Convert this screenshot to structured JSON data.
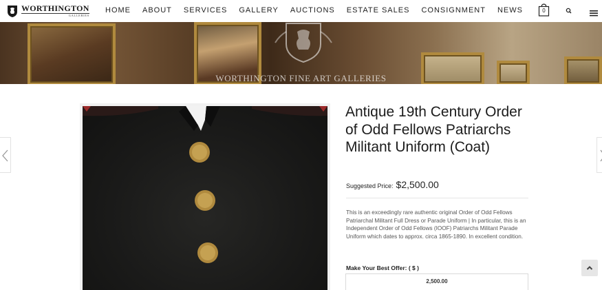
{
  "brand": {
    "name": "WORTHINGTON",
    "sub": "GALLERIES"
  },
  "nav": {
    "items": [
      {
        "label": "HOME"
      },
      {
        "label": "ABOUT"
      },
      {
        "label": "SERVICES"
      },
      {
        "label": "GALLERY"
      },
      {
        "label": "AUCTIONS"
      },
      {
        "label": "ESTATE SALES"
      },
      {
        "label": "CONSIGNMENT"
      },
      {
        "label": "NEWS"
      }
    ],
    "cart_count": "0",
    "icons": [
      "shopping-bag-icon",
      "search-icon",
      "menu-icon"
    ]
  },
  "hero": {
    "title": "WORTHINGTON FINE ART GALLERIES"
  },
  "product": {
    "title": "Antique 19th Century Order of Odd Fellows Patriarchs Militant Uniform (Coat)",
    "price_label": "Suggested Price:",
    "price": "$2,500.00",
    "description": "This is an exceedingly rare authentic original Order of Odd Fellows Patriarchal Militant Full Dress or Parade Uniform | In particular, this is an Independent Order of Odd Fellows (IOOF) Patriarchs Militant Parade Uniform which dates to approx. circa 1865-1890.  In excellent condition.",
    "offer_label": "Make Your Best Offer: ( $ )",
    "offer_value": "2,500.00"
  },
  "colors": {
    "accent": "#b08a3e",
    "text": "#222222",
    "muted": "#555555"
  }
}
